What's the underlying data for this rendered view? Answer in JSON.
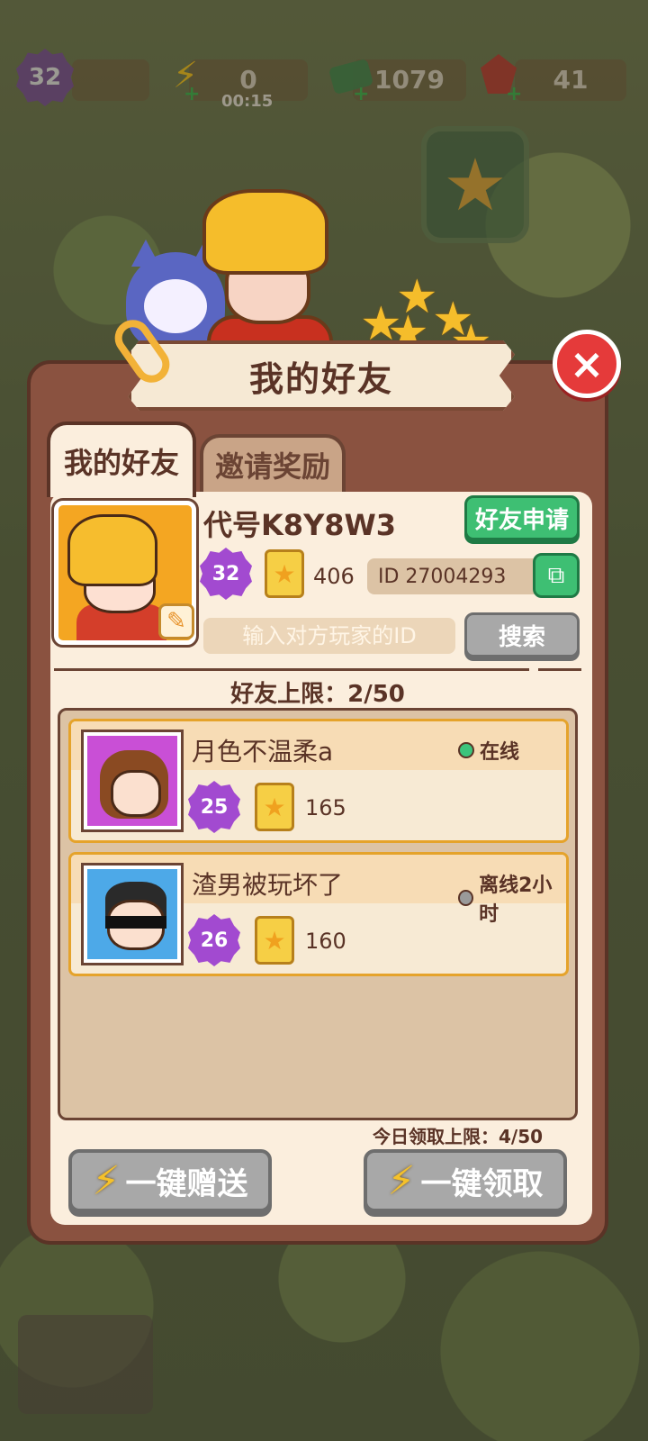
{
  "hud": {
    "level": "32",
    "energy": "0",
    "energy_timer": "00:15",
    "cash": "1079",
    "gems": "41"
  },
  "title": "我的好友",
  "tabs": [
    {
      "label": "我的好友",
      "active": true
    },
    {
      "label": "邀请奖励",
      "active": false
    }
  ],
  "profile": {
    "name": "代号K8Y8W3",
    "level": "32",
    "stars": "406",
    "id_text": "ID 27004293",
    "friend_request_label": "好友申请",
    "search_placeholder": "输入对方玩家的ID",
    "search_label": "搜索"
  },
  "friend_limit": "好友上限：2/50",
  "friends": [
    {
      "name": "月色不温柔a",
      "level": "25",
      "stars": "165",
      "status": "在线",
      "status_color": "#3cc47c"
    },
    {
      "name": "渣男被玩坏了",
      "level": "26",
      "stars": "160",
      "status": "离线2小时",
      "status_color": "#9a9a9a"
    }
  ],
  "claim_limit": "今日领取上限：4/50",
  "actions": {
    "send_all": "一键赠送",
    "claim_all": "一键领取"
  },
  "icons": {
    "close": "×",
    "star": "★",
    "bolt": "⚡",
    "pencil": "✎",
    "copy": "⧉"
  }
}
